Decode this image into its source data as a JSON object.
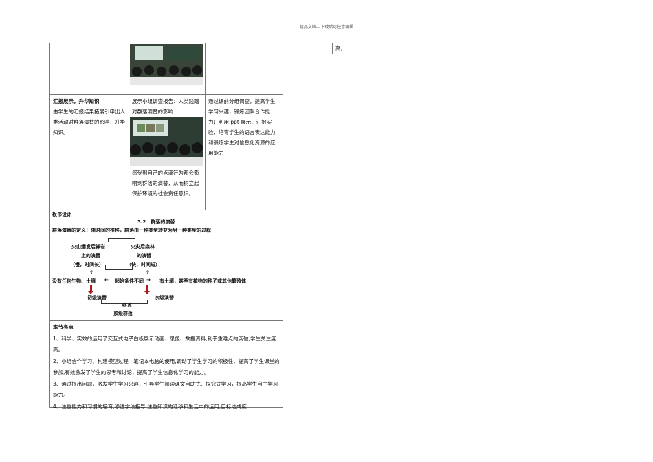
{
  "header": "精品文档---下载后可任意编辑",
  "row2": {
    "title": "汇报展示，升华知识",
    "desc": "由学生的汇报结果拓展引申出人类活动对群落演替的影响，升华知识。",
    "activity_top": "展示小组调查报告：人类践踏对群落演替的影响",
    "activity_bottom": "感受到自己的点滴行为都会影响到群落的演替，从而树立起保护环境的社会责任意识。",
    "intent": "通过课前分组调查，提高学生学习兴趣，锻炼团队合作能力；利用 ppt 展示、汇报实验，培育学生的语言表达能力和锻炼学生对信息化资源的应用能力"
  },
  "board": {
    "title": "板书设计",
    "heading": "3.2　群落的演替",
    "definition": "群落演替的定义：随时间的推移，群落由一种类型转变为另一种类型的过程",
    "left1": "火山爆发后裸岩",
    "left2": "上的演替",
    "left3": "（慢，时间长）",
    "right1": "火灾后森林",
    "right2": "的演替",
    "right3": "（快，时间短）",
    "up_arrow": "⇧",
    "left_cond": "没有任何生物、土壤",
    "left_arrow": "←",
    "center": "起始条件不同",
    "right_arrow": "→",
    "right_cond": "有土壤，甚至有植物的种子或其他繁殖体",
    "primary": "初级演替",
    "secondary": "次级演替",
    "end_label": "终点",
    "climax": "顶级群落"
  },
  "highlights": {
    "title": "本节亮点",
    "items": [
      "1、科学、实效的运用了交互式电子白板展示动画、录像、数据资料,利于重难点的突破,学生关注度高。",
      "2、小组合作学习、构建模型过程中笔记本电脑的使用,调动了学生学习的积极性，提高了学生课堂的参加,有效激发了学生的思考和讨论，提高了学生信息化学习的能力。",
      "3、通过提出问题，激发学生学习兴趣，引导学生阅读课文自助式、探究式学习，提高学生自主学习能力。",
      "4、注重能力和习惯的培育,渗透学法指导,注重知识的迁移和生活中的运用,目标达成度"
    ]
  },
  "right_box": "高。"
}
